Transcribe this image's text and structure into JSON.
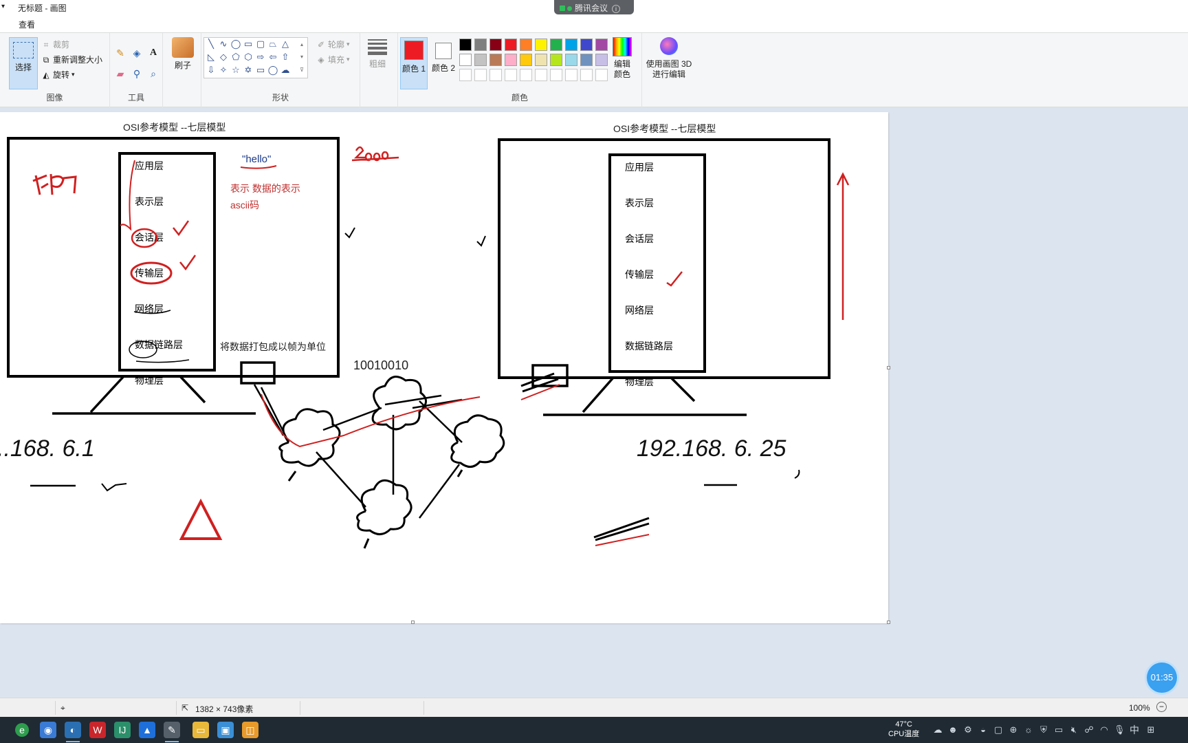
{
  "window": {
    "title": "无标题 - 画图",
    "menu_tab": "查看"
  },
  "meeting": {
    "label": "腾讯会议"
  },
  "ribbon": {
    "image_group": {
      "select": "选择",
      "crop": "裁剪",
      "resize": "重新调整大小",
      "rotate": "旋转",
      "label": "图像"
    },
    "tools_group": {
      "label": "工具"
    },
    "brush": "刷子",
    "shapes_group": {
      "outline": "轮廓",
      "fill": "填充",
      "label": "形状"
    },
    "thickness": "粗细",
    "color1": "颜色 1",
    "color2": "颜色 2",
    "colors_label": "颜色",
    "edit_colors": "编辑颜色",
    "paint3d": "使用画图 3D 进行编辑",
    "palette": [
      "#000000",
      "#7f7f7f",
      "#880015",
      "#ed1c24",
      "#ff7f27",
      "#fff200",
      "#22b14c",
      "#00a2e8",
      "#3f48cc",
      "#a349a4",
      "#ffffff",
      "#c3c3c3",
      "#b97a57",
      "#ffaec9",
      "#ffc90e",
      "#efe4b0",
      "#b5e61d",
      "#99d9ea",
      "#7092be",
      "#c8bfe7",
      "#ffffff",
      "#ffffff",
      "#ffffff",
      "#ffffff",
      "#ffffff",
      "#ffffff",
      "#ffffff",
      "#ffffff",
      "#ffffff",
      "#ffffff"
    ],
    "active_color": "#ed1c24"
  },
  "canvas": {
    "left_title": "OSI参考模型 --七层模型",
    "right_title": "OSI参考模型 --七层模型",
    "layers": [
      "应用层",
      "表示层",
      "会话层",
      "传输层",
      "网络层",
      "数据链路层",
      "物理层"
    ],
    "hello": "\"hello\"",
    "note_presentation": "表示  数据的表示",
    "note_ascii": "ascii码",
    "note_datalink": "将数据打包成以帧为单位",
    "bits": "10010010",
    "ip_left": "..168. 6.1",
    "ip_right": "192.168. 6. 25"
  },
  "timer": "01:35",
  "status": {
    "dimensions": "1382 × 743像素",
    "zoom": "100%"
  },
  "taskbar": {
    "temperature": "47°C",
    "cpu_label": "CPU温度",
    "ime": "中"
  }
}
